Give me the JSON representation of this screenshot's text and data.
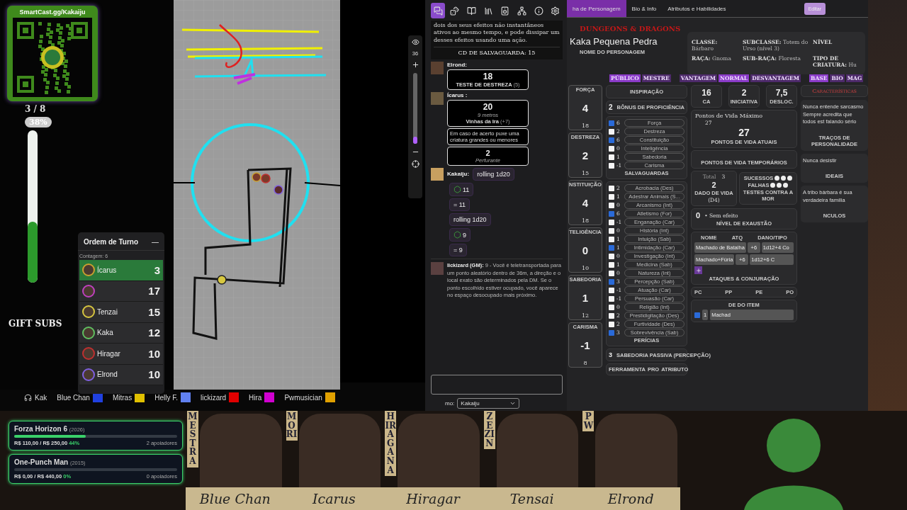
{
  "qr_card": {
    "title": "SmartCast.gg/Kakaiju"
  },
  "vote_meter": {
    "count": "3 / 8",
    "percent": "38%",
    "level": 0.4
  },
  "gift_subs": "GIFT SUBS",
  "turn_order": {
    "title": "Ordem de Turno",
    "collapse": "—",
    "count": "Contagem: 6",
    "entries": [
      {
        "name": "Ícarus",
        "initiative": "3",
        "selected": true,
        "color": "#c8a030"
      },
      {
        "initiative": "17",
        "selected": false,
        "color": "#c040c0"
      },
      {
        "name": "Tenzai",
        "initiative": "15",
        "selected": false,
        "color": "#d8c840"
      },
      {
        "name": "Kaka",
        "initiative": "12",
        "selected": false,
        "color": "#60c060"
      },
      {
        "name": "Hiragar",
        "initiative": "10",
        "selected": false,
        "color": "#c03030"
      },
      {
        "name": "Elrond",
        "initiative": "10",
        "selected": false,
        "color": "#8060e0"
      }
    ]
  },
  "map": {
    "zoom": "36",
    "level": 0.1
  },
  "legend": [
    {
      "name": "Kak",
      "kind": "voice"
    },
    {
      "name": "Blue Chan",
      "kind": "player",
      "color": "#2040e0"
    },
    {
      "name": "Mitras",
      "kind": "player",
      "color": "#e0c000"
    },
    {
      "name": "Helly F.",
      "kind": "player",
      "color": "#6080f0"
    },
    {
      "name": "lickizard",
      "kind": "player",
      "color": "#e00000"
    },
    {
      "name": "Hira",
      "kind": "player",
      "color": "#d000d0"
    },
    {
      "name": "Pwmusician",
      "kind": "player",
      "color": "#e0a000"
    }
  ],
  "goals": [
    {
      "title": "Forza Horizon 6",
      "year": "(2026)",
      "amounts": "R$ 110,00 / R$ 250,00",
      "percent": "44%",
      "level": 0.44,
      "supporters": "2 apoiadores"
    },
    {
      "title": "One-Punch Man",
      "year": "(2015)",
      "amounts": "R$ 0,00 / R$ 440,00",
      "percent": "0%",
      "level": 0,
      "supporters": "0 apoiadores"
    }
  ],
  "chat": {
    "tools": [
      {
        "kind": "chat",
        "selected": true
      },
      {
        "kind": "dice",
        "selected": false
      },
      {
        "kind": "book",
        "selected": false
      },
      {
        "kind": "library",
        "selected": false
      },
      {
        "kind": "speaker",
        "selected": false
      },
      {
        "kind": "nodes",
        "selected": false
      },
      {
        "kind": "info",
        "selected": false
      },
      {
        "kind": "settings",
        "selected": false
      }
    ],
    "spell_text": "dois dos seus efeitos não instantâneos ativos ao mesmo tempo, e pode dissipar um desses efeitos usando uma ação.",
    "save_dc": "CD DE SALVAGUARDA: 15",
    "messages": [
      {
        "kind": "check",
        "author": "Elrond:",
        "result": "18",
        "label": "TESTE DE DESTREZA",
        "bonus": "(5)"
      },
      {
        "kind": "attack",
        "author": "Ícarus :",
        "result": "20",
        "range": "9 metros",
        "label": "Vinhas da Ira",
        "bonus": "(+7)",
        "description": "Em caso de acerto puxe uma criatura grandes ou menores",
        "damage": "2",
        "damage_type": "Perfurante"
      },
      {
        "kind": "text",
        "author": "Kakaiju:",
        "text": "rolling 1d20"
      },
      {
        "kind": "die",
        "text": "11"
      },
      {
        "kind": "total",
        "text": "= 11"
      },
      {
        "kind": "text",
        "text": "rolling 1d20"
      },
      {
        "kind": "die",
        "text": "9"
      },
      {
        "kind": "total",
        "text": "= 9"
      },
      {
        "kind": "gm",
        "author": "lickizard (GM):",
        "text": "9 - Você é teletransportada para um ponto aleatório dentro de 36m, a direção e o local exato são determinados pela DM. Se o ponto escolhido estiver ocupado, você aparece no espaço desocupado mais próximo."
      }
    ],
    "speaker_label": "mo:",
    "speaker": "Kakaiju"
  },
  "sheet": {
    "tabs": [
      {
        "label": "ha de Personagem",
        "selected": true
      },
      {
        "label": "Bio & Info",
        "selected": false
      },
      {
        "label": "Atributos e Habilidades",
        "selected": false
      }
    ],
    "edit_button": "Editar",
    "logo": "DUNGEONS & DRAGONS",
    "character_name": "Kaka Pequena Pedra",
    "name_label": "NOME DO PERSONAGEM",
    "info": [
      {
        "label": "CLASSE:",
        "value": "Bárbaro"
      },
      {
        "label": "SUBCLASSE:",
        "value": "Totem do Urso (nível 3)"
      },
      {
        "label": "NÍVEL"
      },
      {
        "label": "RAÇA:",
        "value": "Gnoma"
      },
      {
        "label": "SUB-RAÇA:",
        "value": "Floresta"
      },
      {
        "label": "TIPO DE CRIATURA:",
        "value": "Hu"
      }
    ],
    "toggle_groups": [
      [
        {
          "label": "PÚBLICO",
          "selected": true
        },
        {
          "label": "MESTRE",
          "selected": false
        }
      ],
      [
        {
          "label": "VANTAGEM",
          "selected": false
        },
        {
          "label": "NORMAL",
          "selected": true
        },
        {
          "label": "DESVANTAGEM",
          "selected": false
        }
      ],
      [
        {
          "label": "BASE",
          "selected": true
        },
        {
          "label": "BIO",
          "selected": false
        },
        {
          "label": "MAG",
          "selected": false
        }
      ]
    ],
    "abilities": [
      {
        "label": "FORÇA",
        "modifier": "4",
        "score": "18"
      },
      {
        "label": "DESTREZA",
        "modifier": "2",
        "score": "15"
      },
      {
        "label": "NSTITUIÇÃO",
        "modifier": "4",
        "score": "18"
      },
      {
        "label": "TELIGÊNCIA",
        "modifier": "0",
        "score": "10"
      },
      {
        "label": "SABEDORIA",
        "modifier": "1",
        "score": "12"
      },
      {
        "label": "CARISMA",
        "modifier": "-1",
        "score": "8"
      }
    ],
    "inspiration": "INSPIRAÇÃO",
    "proficiency": "2",
    "proficiency_label": "BÔNUS DE PROFICIÊNCIA",
    "saves": [
      {
        "value": "6",
        "name": "Força",
        "checked": true
      },
      {
        "value": "2",
        "name": "Destreza",
        "checked": false
      },
      {
        "value": "6",
        "name": "Constituição",
        "checked": true
      },
      {
        "value": "0",
        "name": "Inteligência",
        "checked": false
      },
      {
        "value": "1",
        "name": "Sabedoria",
        "checked": false
      },
      {
        "value": "-1",
        "name": "Carisma",
        "checked": false
      }
    ],
    "saves_label": "SALVAGUARDAS",
    "skills": [
      {
        "value": "2",
        "name": "Acrobacia (Des)",
        "checked": false
      },
      {
        "value": "1",
        "name": "Adestrar Animais (S...",
        "checked": false
      },
      {
        "value": "0",
        "name": "Arcanismo (Int)",
        "checked": false
      },
      {
        "value": "6",
        "name": "Atletismo (For)",
        "checked": true
      },
      {
        "value": "-1",
        "name": "Enganação (Car)",
        "checked": false
      },
      {
        "value": "0",
        "name": "História (Int)",
        "checked": false
      },
      {
        "value": "1",
        "name": "Intuição (Sab)",
        "checked": false
      },
      {
        "value": "1",
        "name": "Intimidação (Car)",
        "checked": true
      },
      {
        "value": "0",
        "name": "Investigação (Int)",
        "checked": false
      },
      {
        "value": "1",
        "name": "Medicina (Sab)",
        "checked": false
      },
      {
        "value": "0",
        "name": "Natureza (Int)",
        "checked": false
      },
      {
        "value": "3",
        "name": "Percepção (Sab)",
        "checked": true
      },
      {
        "value": "-1",
        "name": "Atuação (Car)",
        "checked": false
      },
      {
        "value": "-1",
        "name": "Persuasão (Car)",
        "checked": false
      },
      {
        "value": "0",
        "name": "Religião (Int)",
        "checked": false
      },
      {
        "value": "2",
        "name": "Prestidigitação (Des)",
        "checked": false
      },
      {
        "value": "2",
        "name": "Furtividade (Des)",
        "checked": false
      },
      {
        "value": "3",
        "name": "Sobrevivência (Sab)",
        "checked": true
      }
    ],
    "skills_label": "PERÍCIAS",
    "passive": "3",
    "passive_label": "SABEDORIA PASSIVA (PERCEPÇÃO)",
    "tool_columns": [
      "FERRAMENTA",
      "PRO",
      "ATRIBUTO"
    ],
    "armor_class": "16",
    "armor_label": "CA",
    "initiative": "2",
    "initiative_label": "INICIATIVA",
    "speed": "7,5",
    "speed_label": "DESLOC.",
    "hp_max_label": "Pontos de Vida Máximo",
    "hp_max": "27",
    "hp_current": "27",
    "hp_current_label": "PONTOS DE VIDA ATUAIS",
    "hp_temp_label": "PONTOS DE VIDA TEMPORÁRIOS",
    "hit_dice_total_label": "Total",
    "hit_dice_total": "3",
    "hit_dice": "2",
    "hit_dice_label": "DADO DE VIDA",
    "hit_die": "(D4)",
    "successes_label": "SUCESSOS",
    "failures_label": "FALHAS",
    "death_saves_label": "TESTES CONTRA A MOR",
    "exhaustion": "0",
    "exhaustion_note": "• Sem efeito",
    "exhaustion_label": "NÍVEL DE EXAUSTÃO",
    "attack_columns": [
      "NOME",
      "ATQ",
      "DANO/TIPO"
    ],
    "attacks": [
      {
        "name": "Machado de Batalha",
        "bonus": "+6",
        "damage": "1d12+4 Co"
      },
      {
        "name": "Machado+Fúria",
        "bonus": "+6",
        "damage": "1d12+6 C"
      }
    ],
    "attacks_label": "ATAQUES & CONJURAÇÃO",
    "coins": [
      "PC",
      "PP",
      "PE",
      "PO"
    ],
    "item_column": "DE DO ITEM",
    "item_qty": "1",
    "item_name": "Machad",
    "item_checked": true,
    "traits_title": "Características",
    "traits": [
      {
        "text": "Nunca entende sarcasmo Sempre acredita que todos est falando sério",
        "label": "TRAÇOS DE PERSONALIDADE"
      },
      {
        "text": "Nunca desistir",
        "label": "IDEAIS"
      },
      {
        "text": "A tribo bárbara é sua verdadeira família",
        "label": "NCULOS"
      }
    ]
  },
  "portraits": [
    {
      "tag": "MESTRA",
      "name": "Blue Chan"
    },
    {
      "tag": "MORI",
      "name": "Icarus"
    },
    {
      "tag": "HIRAGANA",
      "name": "Hiragar"
    },
    {
      "tag": "ZEZIN",
      "name": "Tensai"
    },
    {
      "tag": "PW",
      "name": "Elrond"
    }
  ]
}
